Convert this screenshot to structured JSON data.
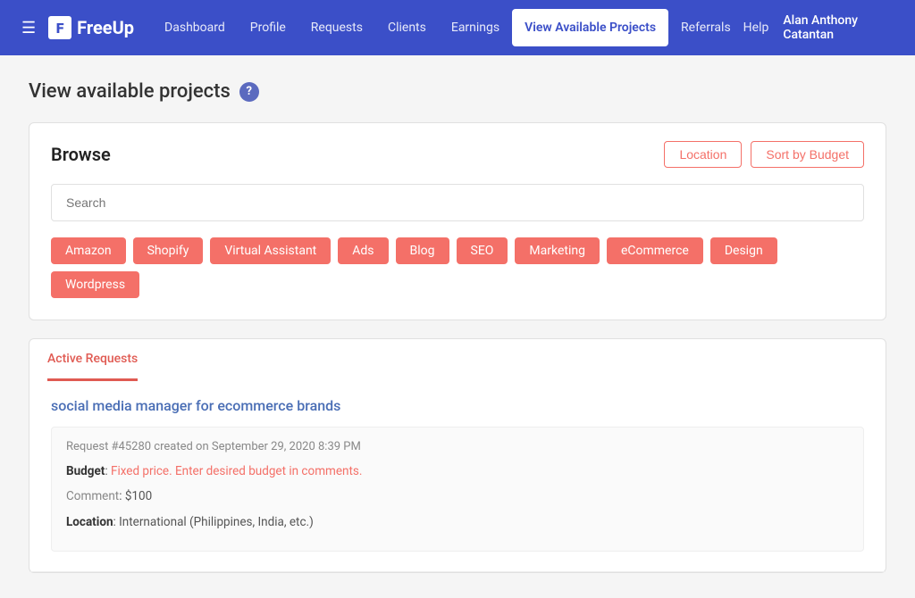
{
  "navbar": {
    "hamburger_icon": "☰",
    "logo_f": "F",
    "logo_text": "FreeUp",
    "links": [
      {
        "id": "dashboard",
        "label": "Dashboard",
        "active": false
      },
      {
        "id": "profile",
        "label": "Profile",
        "active": false
      },
      {
        "id": "requests",
        "label": "Requests",
        "active": false
      },
      {
        "id": "clients",
        "label": "Clients",
        "active": false
      },
      {
        "id": "earnings",
        "label": "Earnings",
        "active": false
      },
      {
        "id": "view-available-projects",
        "label": "View Available Projects",
        "active": true
      },
      {
        "id": "referrals",
        "label": "Referrals",
        "active": false
      }
    ],
    "help_label": "Help",
    "user_name": "Alan Anthony Catantan"
  },
  "page": {
    "title": "View available projects",
    "help_icon": "?",
    "browse": {
      "title": "Browse",
      "location_btn": "Location",
      "sort_btn": "Sort by Budget",
      "search_placeholder": "Search",
      "tags": [
        "Amazon",
        "Shopify",
        "Virtual Assistant",
        "Ads",
        "Blog",
        "SEO",
        "Marketing",
        "eCommerce",
        "Design",
        "Wordpress"
      ]
    },
    "tabs": [
      {
        "id": "active-requests",
        "label": "Active Requests",
        "active": true
      }
    ],
    "projects": [
      {
        "id": "45280",
        "title": "social media manager for ecommerce brands",
        "meta": "Request #45280 created on September 29, 2020 8:39 PM",
        "budget_label": "Budget",
        "budget_value": "Fixed price. Enter desired budget in comments.",
        "comment_label": "Comment",
        "comment_value": "$100",
        "location_label": "Location",
        "location_value": "International (Philippines, India, etc.)"
      }
    ]
  }
}
